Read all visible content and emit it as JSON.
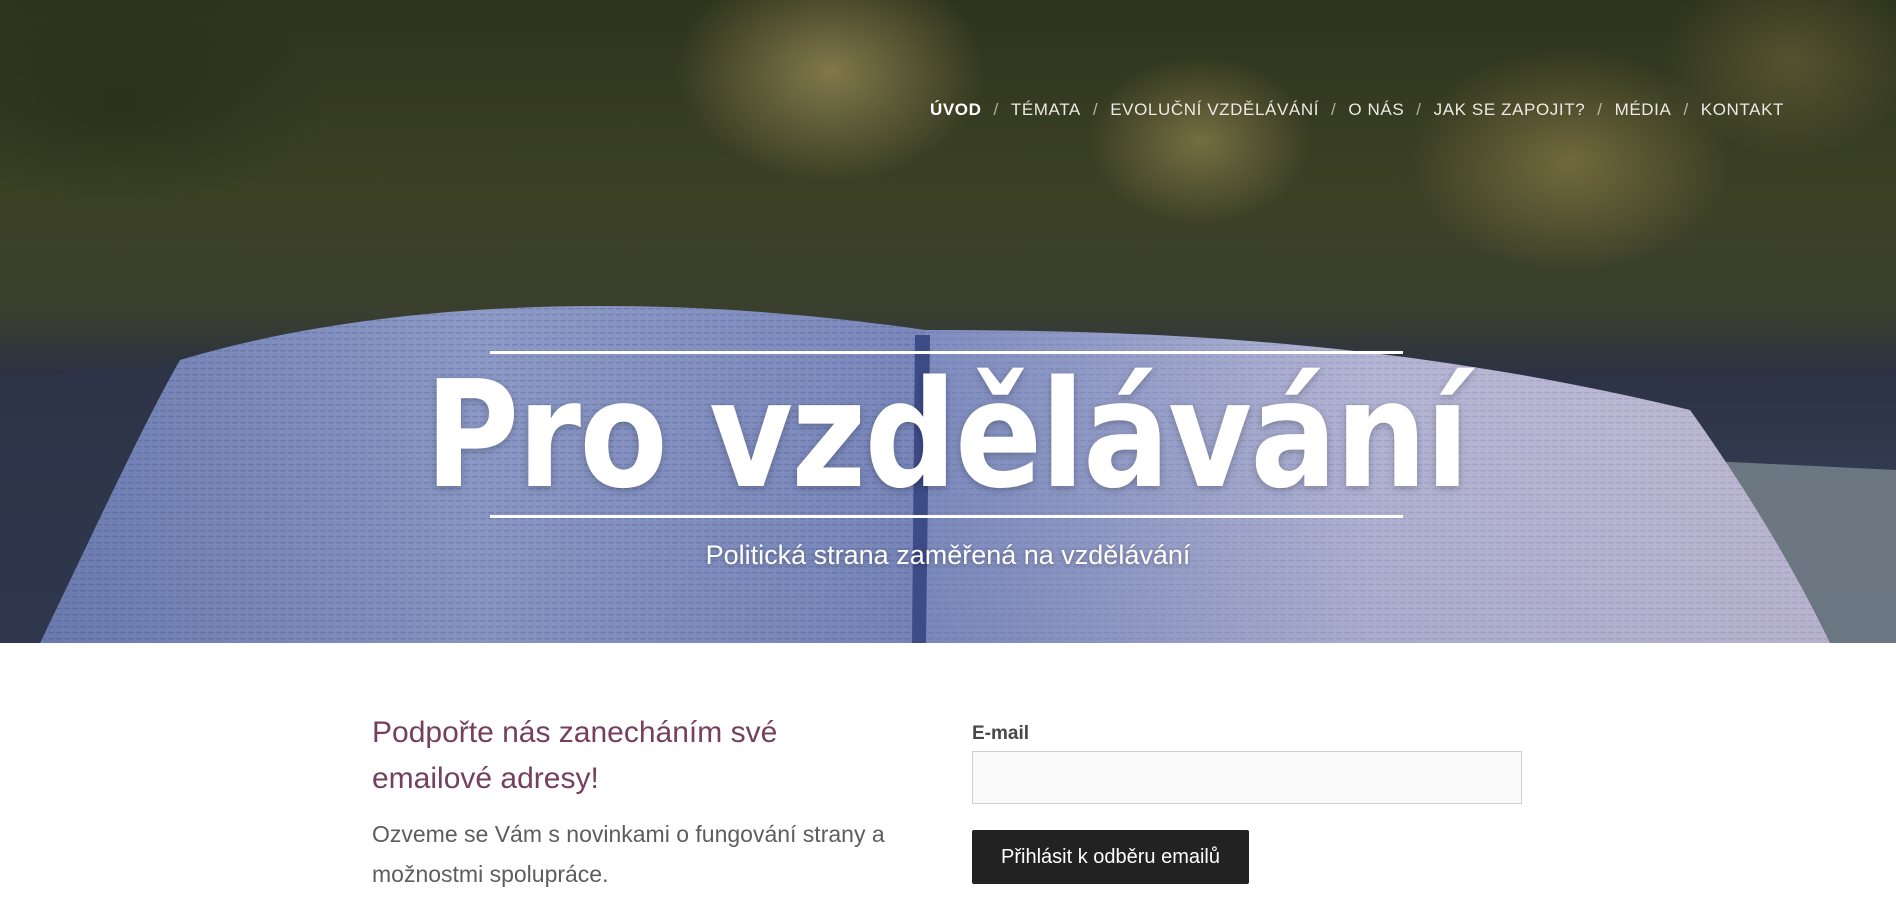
{
  "nav": {
    "items": [
      {
        "label": "ÚVOD",
        "active": true
      },
      {
        "label": "TÉMATA",
        "active": false
      },
      {
        "label": "EVOLUČNÍ VZDĚLÁVÁNÍ",
        "active": false
      },
      {
        "label": "O NÁS",
        "active": false
      },
      {
        "label": "JAK SE ZAPOJIT?",
        "active": false
      },
      {
        "label": "MÉDIA",
        "active": false
      },
      {
        "label": "KONTAKT",
        "active": false
      }
    ],
    "separator": "/"
  },
  "hero": {
    "title": "Pro vzdělávání",
    "subtitle": "Politická strana zaměřená na vzdělávání",
    "background": "open-book-photo"
  },
  "signup": {
    "heading": "Podpořte nás zanecháním své emailové adresy!",
    "text": "Ozveme se Vám s novinkami o fungování strany a možnostmi spolupráce.",
    "email_label": "E-mail",
    "email_value": "",
    "button_label": "Přihlásit k odběru emailů"
  },
  "colors": {
    "heading": "#74405d",
    "button_bg": "#222222",
    "text": "#5d5d5d"
  }
}
